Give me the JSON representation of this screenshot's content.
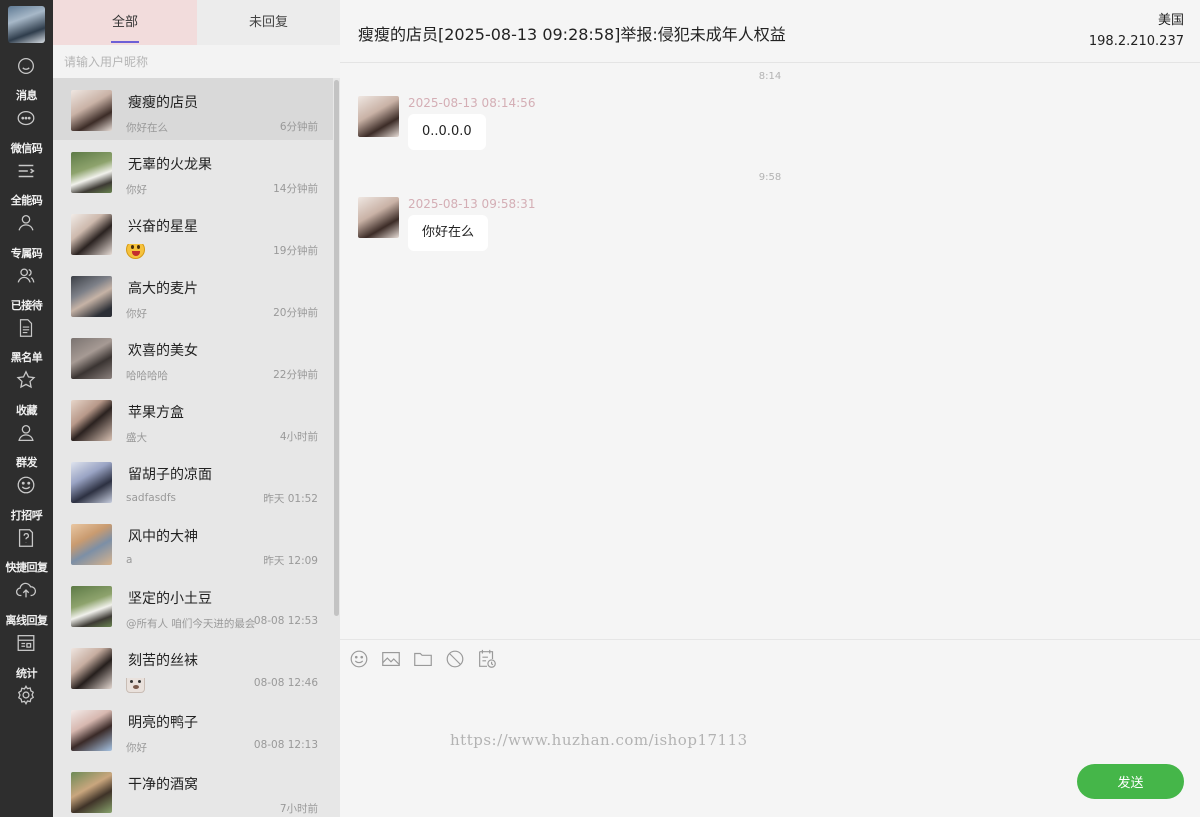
{
  "sidebar": {
    "items": [
      {
        "icon": "smile-icon",
        "label": ""
      },
      {
        "icon": "chat-bubble-icon",
        "label": "消息"
      },
      {
        "icon": "list-icon",
        "label": "微信码"
      },
      {
        "icon": "user-icon",
        "label": "全能码"
      },
      {
        "icon": "users-icon",
        "label": "专属码"
      },
      {
        "icon": "document-icon",
        "label": "已接待"
      },
      {
        "icon": "star-icon",
        "label": "黑名单"
      },
      {
        "icon": "user-outline-icon",
        "label": "收藏"
      },
      {
        "icon": "smile-face-icon",
        "label": "群发"
      },
      {
        "icon": "question-note-icon",
        "label": "打招呼"
      },
      {
        "icon": "cloud-upload-icon",
        "label": "快捷回复"
      },
      {
        "icon": "calendar-icon",
        "label": "离线回复"
      },
      {
        "icon": "gear-icon",
        "label": "统计"
      }
    ]
  },
  "tabs": {
    "all": "全部",
    "unreplied": "未回复"
  },
  "search": {
    "placeholder": "请输入用户昵称"
  },
  "contacts": [
    {
      "name": "瘦瘦的店员",
      "message": "你好在么",
      "time": "6分钟前"
    },
    {
      "name": "无辜的火龙果",
      "message": "你好",
      "time": "14分钟前"
    },
    {
      "name": "兴奋的星星",
      "message": "",
      "time": "19分钟前"
    },
    {
      "name": "高大的麦片",
      "message": "你好",
      "time": "20分钟前"
    },
    {
      "name": "欢喜的美女",
      "message": "哈哈哈哈",
      "time": "22分钟前"
    },
    {
      "name": "苹果方盒",
      "message": "盛大",
      "time": "4小时前"
    },
    {
      "name": "留胡子的凉面",
      "message": "sadfasdfs",
      "time": "昨天 01:52"
    },
    {
      "name": "风中的大神",
      "message": "a",
      "time": "昨天 12:09"
    },
    {
      "name": "坚定的小土豆",
      "message": "@所有人 咱们今天进的最会",
      "time": "08-08 12:53"
    },
    {
      "name": "刻苦的丝袜",
      "message": "",
      "time": "08-08 12:46"
    },
    {
      "name": "明亮的鸭子",
      "message": "你好",
      "time": "08-08 12:13"
    },
    {
      "name": "干净的酒窝",
      "message": "",
      "time": "7小时前"
    }
  ],
  "chat": {
    "title": "瘦瘦的店员[2025-08-13 09:28:58]举报:侵犯未成年人权益",
    "country": "美国",
    "ip": "198.2.210.237",
    "messages": [
      {
        "separator": "8:14",
        "timestamp": "2025-08-13 08:14:56",
        "text": "0..0.0.0"
      },
      {
        "separator": "9:58",
        "timestamp": "2025-08-13 09:58:31",
        "text": "你好在么"
      }
    ],
    "watermark": "https://www.huzhan.com/ishop17113",
    "send_label": "发送"
  },
  "colors": {
    "rail": "#2e2e2e",
    "accent": "#6d5fd6",
    "send": "#45b649",
    "timestamp": "#d4aeb5"
  }
}
